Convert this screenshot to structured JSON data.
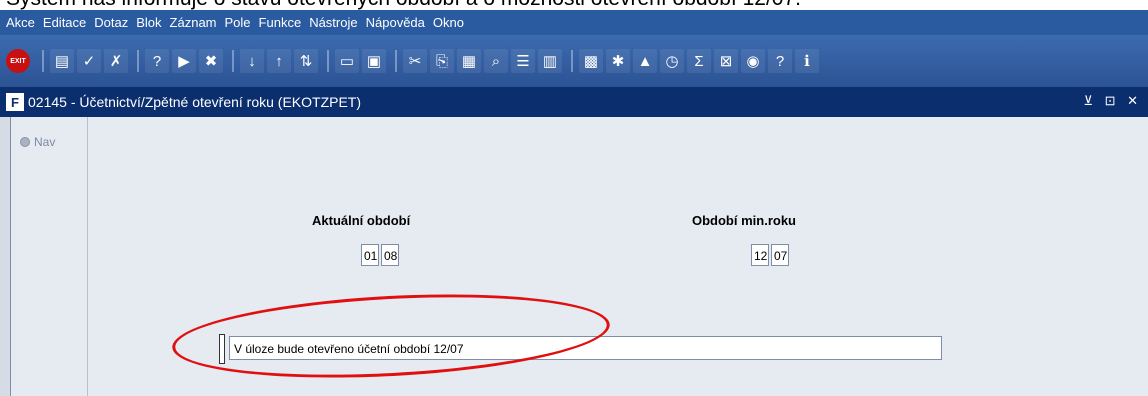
{
  "caption": "Systém nás informuje o stavu otevřených období a o možnosti otevření období 12/07.",
  "menu": [
    "Akce",
    "Editace",
    "Dotaz",
    "Blok",
    "Záznam",
    "Pole",
    "Funkce",
    "Nástroje",
    "Nápověda",
    "Okno"
  ],
  "toolbar": {
    "exit_label": "EXIT",
    "icons": [
      "save-icon",
      "accept-icon",
      "clear-icon",
      "query-icon",
      "execute-query-icon",
      "delete-record-icon",
      "sort-asc-icon",
      "sort-desc-icon",
      "filter-icon",
      "print-icon",
      "print-preview-icon",
      "cut-icon",
      "copy-icon",
      "paste-icon",
      "find-icon",
      "list-icon",
      "columns-icon",
      "export-icon",
      "settings-icon",
      "chart-icon",
      "clock-icon",
      "sum-icon",
      "excel-icon",
      "browser-icon",
      "help-icon",
      "info-icon"
    ]
  },
  "window": {
    "logo": "F",
    "title": "02145 - Účetnictví/Zpětné otevření roku (EKOTZPET)",
    "controls": "⊻ ⊡ ✕"
  },
  "nav": {
    "label": "Nav"
  },
  "current_period": {
    "label": "Aktuální období",
    "month": "01",
    "year": "08"
  },
  "min_year_period": {
    "label": "Období min.roku",
    "month": "12",
    "year": "07"
  },
  "message": "V úloze bude otevřeno účetní období 12/07",
  "colors": {
    "menubar": "#2a5aa0",
    "titlebar": "#0b2e6e",
    "highlight_ellipse": "#e01010"
  }
}
